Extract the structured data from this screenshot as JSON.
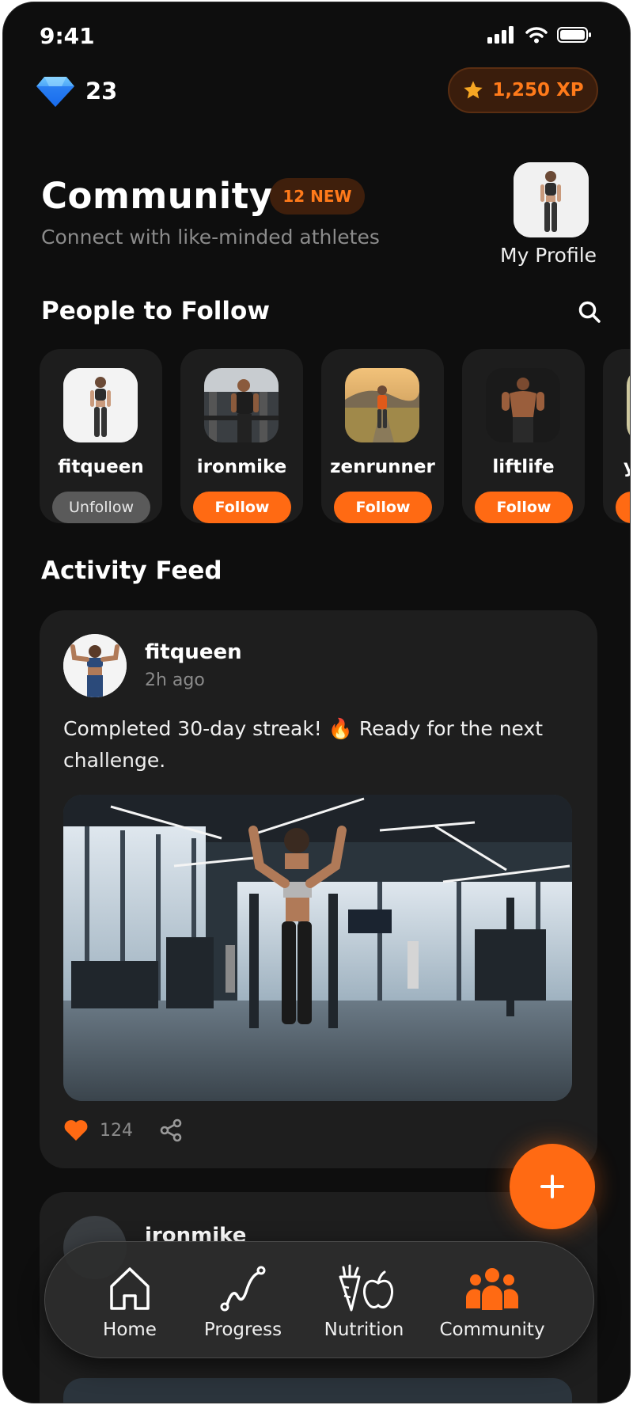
{
  "status_bar": {
    "time": "9:41"
  },
  "header": {
    "gems": "23",
    "xp": "1,250 XP"
  },
  "page": {
    "title": "Community",
    "new_badge": "12 NEW",
    "subtitle": "Connect with like-minded athletes",
    "my_profile_label": "My Profile"
  },
  "people": {
    "section_title": "People to Follow",
    "items": [
      {
        "name": "fitqueen",
        "button": "Unfollow"
      },
      {
        "name": "ironmike",
        "button": "Follow"
      },
      {
        "name": "zenrunner",
        "button": "Follow"
      },
      {
        "name": "liftlife",
        "button": "Follow"
      },
      {
        "name": "y",
        "button": ""
      }
    ]
  },
  "feed": {
    "section_title": "Activity Feed",
    "posts": [
      {
        "user": "fitqueen",
        "time": "2h ago",
        "text": "Completed 30-day streak! 🔥 Ready for the next challenge.",
        "likes": "124"
      },
      {
        "user": "ironmike"
      }
    ]
  },
  "tabs": [
    {
      "label": "Home",
      "icon": "home-icon"
    },
    {
      "label": "Progress",
      "icon": "progress-icon"
    },
    {
      "label": "Nutrition",
      "icon": "nutrition-icon"
    },
    {
      "label": "Community",
      "icon": "community-icon",
      "active": true
    }
  ],
  "colors": {
    "accent": "#ff6a13",
    "background": "#0e0e0e",
    "card": "#1e1e1e"
  }
}
